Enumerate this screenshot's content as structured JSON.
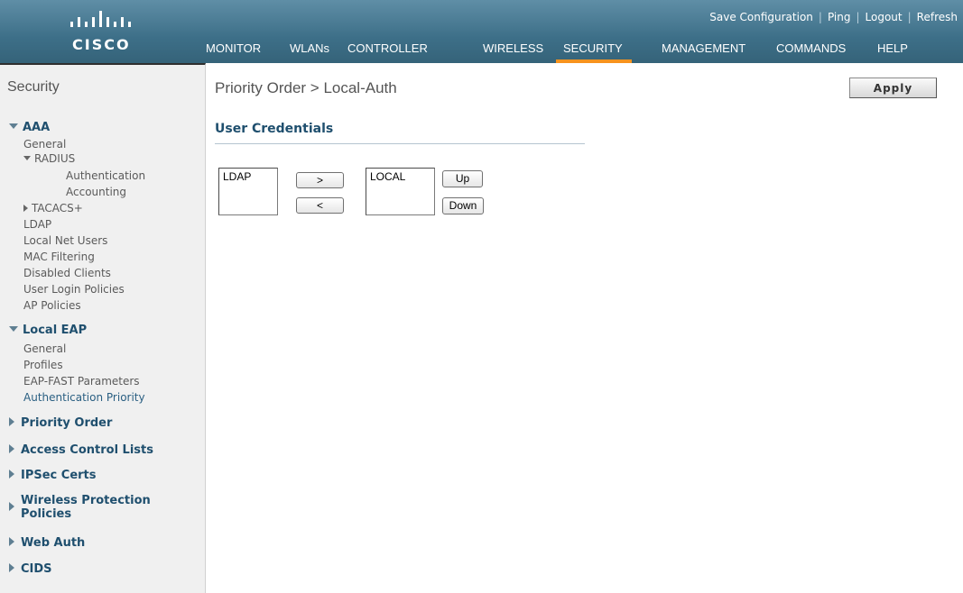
{
  "brand": {
    "logo_text": "CISCO"
  },
  "top_links": [
    "Save Configuration",
    "Ping",
    "Logout",
    "Refresh"
  ],
  "nav": [
    "MONITOR",
    "WLANs",
    "CONTROLLER",
    "WIRELESS",
    "SECURITY",
    "MANAGEMENT",
    "COMMANDS",
    "HELP"
  ],
  "nav_active": "SECURITY",
  "sidebar": {
    "title": "Security",
    "aaa": {
      "label": "AAA",
      "general": "General",
      "radius": "RADIUS",
      "authentication": "Authentication",
      "accounting": "Accounting",
      "tacacs": "TACACS+",
      "items": [
        "LDAP",
        "Local Net Users",
        "MAC Filtering",
        "Disabled Clients",
        "User Login Policies",
        "AP Policies"
      ]
    },
    "local_eap": {
      "label": "Local EAP",
      "items": [
        "General",
        "Profiles",
        "EAP-FAST Parameters",
        "Authentication Priority"
      ]
    },
    "collapsed": [
      "Priority Order",
      "Access Control Lists",
      "IPSec Certs",
      "Wireless Protection",
      "Policies",
      "Web Auth",
      "CIDS"
    ]
  },
  "page": {
    "title": "Priority Order > Local-Auth",
    "apply_label": "Apply",
    "section": "User Credentials",
    "left_list": [
      "LDAP"
    ],
    "right_list": [
      "LOCAL"
    ],
    "move_right": ">",
    "move_left": "<",
    "up": "Up",
    "down": "Down"
  },
  "colors": {
    "header": "#3d6f88",
    "active_tab_underline": "#f7931e",
    "section_text": "#1f4f6e"
  }
}
